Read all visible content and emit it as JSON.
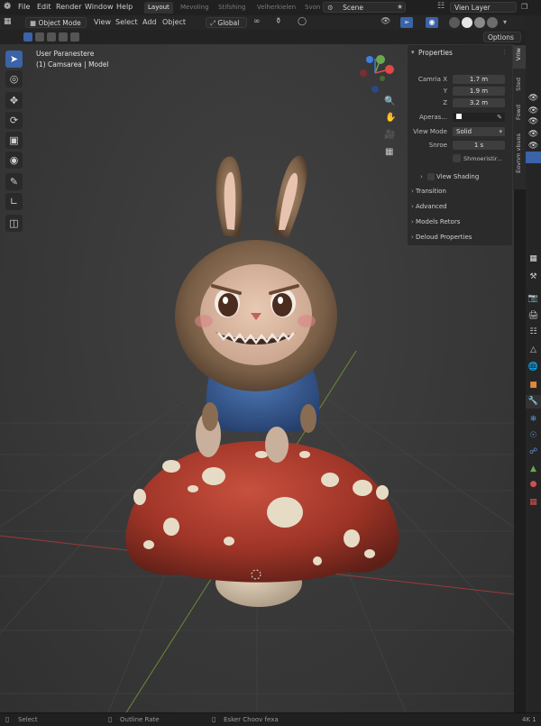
{
  "topbar": {
    "menus": [
      "File",
      "Edit",
      "Render",
      "Window",
      "Help"
    ],
    "workspaces": [
      "Layout",
      "Mevoling",
      "Stifshing",
      "Velherkielen",
      "Svon"
    ],
    "scene": "Scene",
    "view_layer": "Vien Layer"
  },
  "header": {
    "mode": "Object Mode",
    "menus": [
      "View",
      "Select",
      "Add",
      "Object"
    ],
    "transform": "Global"
  },
  "options_label": "Options",
  "viewport": {
    "overlay_line1": "User Paranestere",
    "overlay_line2": "(1) Camsarea | Model"
  },
  "properties": {
    "title": "Properties",
    "camera_x_label": "Camria X",
    "camera_x": "1.7 m",
    "y_label": "Y",
    "y": "1.9 m",
    "z_label": "Z",
    "z": "3.2 m",
    "aperture_label": "Aperas...",
    "view_mode_label": "View Mode",
    "view_mode": "Solid",
    "shade_label": "Snroe",
    "shade_value": "1 s",
    "smooth_label": "Shmoeristir...",
    "view_shading": "View Shading",
    "sections": [
      "Transition",
      "Advanced",
      "Models Retors",
      "Deloud Properties"
    ]
  },
  "side_tabs": [
    "Vriw",
    "Sted",
    "Fowd",
    "Eovnm vbuos"
  ],
  "status": {
    "left": "Select",
    "middle": "Outline Rate",
    "middle2": "Esker Choov fexa",
    "right": "4K 1"
  },
  "colors": {
    "accent_blue": "#3a63a8",
    "axis_red": "#e04848",
    "axis_green": "#6aa84f",
    "axis_blue": "#3f7fe0"
  }
}
